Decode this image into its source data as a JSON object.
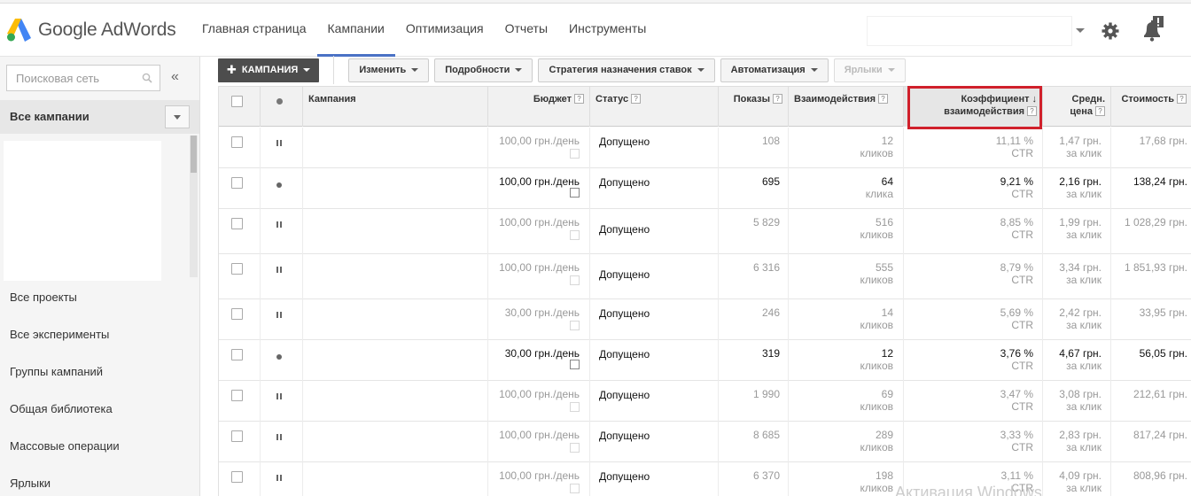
{
  "brand": {
    "name": "Google AdWords",
    "logo_colors": [
      "#4285f4",
      "#fbbc05",
      "#34a853"
    ]
  },
  "nav": {
    "items": [
      {
        "label": "Главная страница",
        "active": false
      },
      {
        "label": "Кампании",
        "active": true
      },
      {
        "label": "Оптимизация",
        "active": false
      },
      {
        "label": "Отчеты",
        "active": false
      },
      {
        "label": "Инструменты",
        "active": false
      }
    ]
  },
  "header_icons": [
    "gear-icon",
    "notification-bell-icon"
  ],
  "sidebar": {
    "search_placeholder": "Поисковая сеть",
    "collapse_label": "«",
    "all_campaigns": "Все кампании",
    "links": [
      "Все проекты",
      "Все эксперименты",
      "Группы кампаний",
      "Общая библиотека",
      "Массовые операции",
      "Ярлыки"
    ]
  },
  "toolbar": {
    "add_campaign": "КАМПАНИЯ",
    "edit": "Изменить",
    "details": "Подробности",
    "bid_strategy": "Стратегия назначения ставок",
    "automate": "Автоматизация",
    "labels": "Ярлыки"
  },
  "table": {
    "headers": {
      "campaign": "Кампания",
      "budget": "Бюджет",
      "status": "Статус",
      "impressions": "Показы",
      "interactions": "Взаимодействия",
      "rate_line1": "Коэффициент",
      "rate_line2": "взаимодействия",
      "avg_line1": "Средн.",
      "avg_line2": "цена",
      "cost": "Стоимость"
    },
    "rows": [
      {
        "state": "paused",
        "budget": "100,00 грн./день",
        "status": "Допущено",
        "impressions": "108",
        "interactions": "12",
        "interactions_unit": "кликов",
        "rate": "11,11 %",
        "rate_unit": "CTR",
        "avg": "1,47 грн.",
        "avg_unit": "за клик",
        "cost": "17,68 грн."
      },
      {
        "state": "active",
        "budget": "100,00 грн./день",
        "status": "Допущено",
        "impressions": "695",
        "interactions": "64",
        "interactions_unit": "клика",
        "rate": "9,21 %",
        "rate_unit": "CTR",
        "avg": "2,16 грн.",
        "avg_unit": "за клик",
        "cost": "138,24 грн."
      },
      {
        "state": "paused",
        "budget": "100,00 грн./день",
        "status": "Допущено",
        "impressions": "5 829",
        "interactions": "516",
        "interactions_unit": "кликов",
        "rate": "8,85 %",
        "rate_unit": "CTR",
        "avg": "1,99 грн.",
        "avg_unit": "за клик",
        "cost": "1 028,29 грн."
      },
      {
        "state": "paused",
        "budget": "100,00 грн./день",
        "status": "Допущено",
        "impressions": "6 316",
        "interactions": "555",
        "interactions_unit": "кликов",
        "rate": "8,79 %",
        "rate_unit": "CTR",
        "avg": "3,34 грн.",
        "avg_unit": "за клик",
        "cost": "1 851,93 грн."
      },
      {
        "state": "paused",
        "budget": "30,00 грн./день",
        "status": "Допущено",
        "impressions": "246",
        "interactions": "14",
        "interactions_unit": "кликов",
        "rate": "5,69 %",
        "rate_unit": "CTR",
        "avg": "2,42 грн.",
        "avg_unit": "за клик",
        "cost": "33,95 грн."
      },
      {
        "state": "active",
        "budget": "30,00 грн./день",
        "status": "Допущено",
        "impressions": "319",
        "interactions": "12",
        "interactions_unit": "кликов",
        "rate": "3,76 %",
        "rate_unit": "CTR",
        "avg": "4,67 грн.",
        "avg_unit": "за клик",
        "cost": "56,05 грн."
      },
      {
        "state": "paused",
        "budget": "100,00 грн./день",
        "status": "Допущено",
        "impressions": "1 990",
        "interactions": "69",
        "interactions_unit": "кликов",
        "rate": "3,47 %",
        "rate_unit": "CTR",
        "avg": "3,08 грн.",
        "avg_unit": "за клик",
        "cost": "212,61 грн."
      },
      {
        "state": "paused",
        "budget": "100,00 грн./день",
        "status": "Допущено",
        "impressions": "8 685",
        "interactions": "289",
        "interactions_unit": "кликов",
        "rate": "3,33 %",
        "rate_unit": "CTR",
        "avg": "2,83 грн.",
        "avg_unit": "за клик",
        "cost": "817,24 грн."
      },
      {
        "state": "paused",
        "budget": "100,00 грн./день",
        "status": "Допущено",
        "impressions": "6 370",
        "interactions": "198",
        "interactions_unit": "кликов",
        "rate": "3,11 %",
        "rate_unit": "CTR",
        "avg": "4,09 грн.",
        "avg_unit": "за клик",
        "cost": "808,96 грн."
      }
    ]
  },
  "watermark": "Активация Windows",
  "accent_colors": {
    "nav_active": "#4a72c5",
    "sort_highlight": "#d0202b",
    "primary_button": "#4d4d4d"
  }
}
